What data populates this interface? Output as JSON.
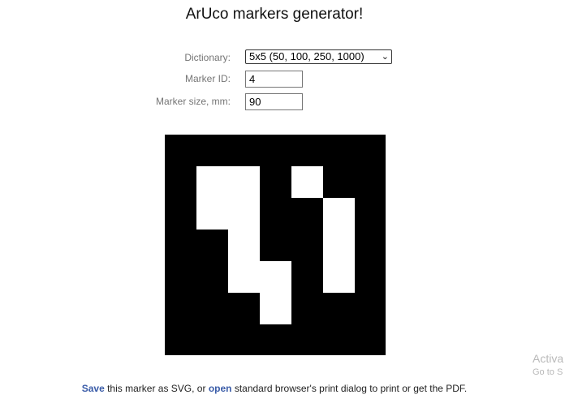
{
  "title": "ArUco markers generator!",
  "form": {
    "dictionary_label": "Dictionary:",
    "dictionary_value": "5x5 (50, 100, 250, 1000)",
    "marker_id_label": "Marker ID:",
    "marker_id_value": "4",
    "marker_size_label": "Marker size, mm:",
    "marker_size_value": "90"
  },
  "marker": {
    "dictionary_size": 5,
    "id": 4,
    "bits": [
      [
        1,
        1,
        0,
        1,
        0
      ],
      [
        1,
        1,
        0,
        0,
        1
      ],
      [
        0,
        1,
        0,
        0,
        1
      ],
      [
        0,
        1,
        1,
        0,
        1
      ],
      [
        0,
        0,
        1,
        0,
        0
      ]
    ]
  },
  "footer": {
    "save_link": "Save",
    "text1": " this marker as SVG, or ",
    "open_link": "open",
    "text2": " standard browser's print dialog to print or get the PDF."
  },
  "watermark": {
    "line1": "Activa",
    "line2": "Go to S"
  }
}
